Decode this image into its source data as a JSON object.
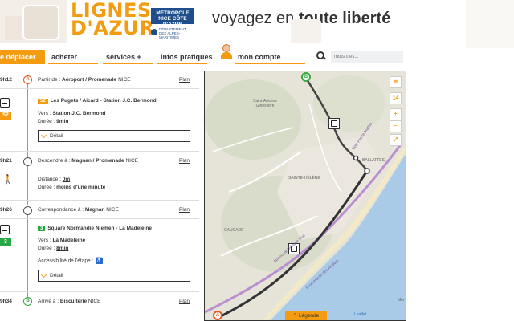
{
  "header": {
    "logo_line1": "LIGNES",
    "logo_line2": "D'AZUR",
    "metropole_line1": "MÉTROPOLE",
    "metropole_line2": "NICE CÔTE D'AZUR",
    "departement_line1": "DÉPARTEMENT",
    "departement_line2": "DES ALPES-MARITIMES",
    "slogan_regular": "voyagez en",
    "slogan_bold": "toute liberté"
  },
  "nav": {
    "items": [
      "e déplacer",
      "acheter",
      "services +",
      "infos pratiques"
    ],
    "account": "mon compte",
    "search_placeholder": "mots clés..."
  },
  "itinerary": {
    "plan_label": "Plan",
    "detail_label": "Détail",
    "steps": [
      {
        "time": "9h12",
        "marker": "A",
        "text_prefix": "Partir de :",
        "place": "Aéroport / Promenade",
        "city": "NICE"
      },
      {
        "line": "52",
        "stop_from": "Les Pugets / Aicard - Station J.C. Bermond",
        "direction_label": "Vers :",
        "direction": "Station J.C. Bermond",
        "duration_label": "Durée :",
        "duration": "9min"
      },
      {
        "time": "9h21",
        "text_prefix": "Descendre à :",
        "place": "Magnan / Promenade",
        "city": "NICE"
      },
      {
        "distance_label": "Distance :",
        "distance": "0m",
        "duration_label": "Durée :",
        "duration": "moins d'une minute"
      },
      {
        "time": "9h26",
        "text_prefix": "Correspondance à :",
        "place": "Magnan",
        "city": "NICE"
      },
      {
        "line": "3",
        "stop_from": "Square Normandie Niemen - La Madeleine",
        "direction_label": "Vers :",
        "direction": "La Madeleine",
        "duration_label": "Durée :",
        "duration": "8min",
        "accessibility_label": "Accessibilité de l'étape :"
      },
      {
        "time": "9h34",
        "marker": "B",
        "text_prefix": "Arrivé à :",
        "place": "Biscuiterie",
        "city": "NICE"
      }
    ]
  },
  "map": {
    "zoom": "14",
    "legend_label": "Légende",
    "attribution": "Leaflet",
    "labels": [
      "Saint-Antoine Ginestière",
      "Voie Pierre Mathis",
      "Autoroute Urbaine Sud",
      "Promenade des Anglais",
      "CAUCADE",
      "BALLATTES",
      "SAINTE-HÉLÈNE",
      "Mer"
    ]
  },
  "colors": {
    "accent": "#f39c11",
    "line52": "#f39c11",
    "line3": "#28a745",
    "metropole": "#1f4e8c"
  }
}
